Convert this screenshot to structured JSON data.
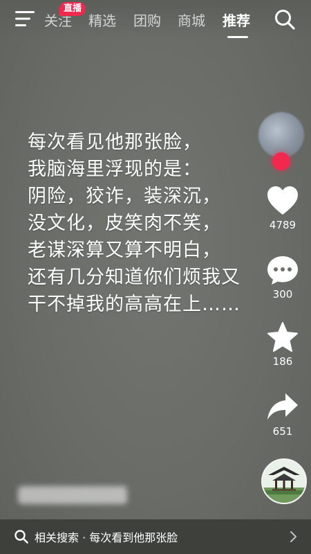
{
  "nav": {
    "tabs": [
      {
        "label": "关注"
      },
      {
        "label": "精选"
      },
      {
        "label": "团购"
      },
      {
        "label": "商城"
      },
      {
        "label": "推荐"
      }
    ],
    "active_tab": "推荐",
    "live_badge": "直播"
  },
  "caption": {
    "lines": [
      "每次看见他那张脸，",
      "我脑海里浮现的是：",
      "阴险，狡诈，装深沉，",
      "没文化，皮笑肉不笑，",
      "老谋深算又算不明白，",
      "还有几分知道你们烦我又",
      "干不掉我的高高在上……"
    ]
  },
  "rail": {
    "likes": "4789",
    "comments": "300",
    "favorites": "186",
    "shares": "651"
  },
  "bottom": {
    "related_search": "相关搜索 · 每次看到他那张脸"
  },
  "colors": {
    "accent": "#f2284f",
    "background": "#6d6f6a",
    "bottom_bar": "#3e403c"
  }
}
